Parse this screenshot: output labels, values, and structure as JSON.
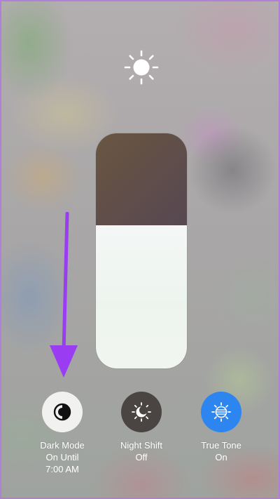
{
  "brightness": {
    "level_percent": 61
  },
  "controls": [
    {
      "label": "Dark Mode",
      "status": "On Until 7:00 AM",
      "icon": "dark-mode-icon",
      "active": true
    },
    {
      "label": "Night Shift",
      "status": "Off",
      "icon": "night-shift-icon",
      "active": false
    },
    {
      "label": "True Tone",
      "status": "On",
      "icon": "true-tone-icon",
      "active": true
    }
  ],
  "colors": {
    "arrow": "#9a3df2",
    "true_tone_active": "#2d86f0",
    "night_shift_bg": "#4a4542",
    "dark_mode_bg": "#f1f1ef"
  }
}
